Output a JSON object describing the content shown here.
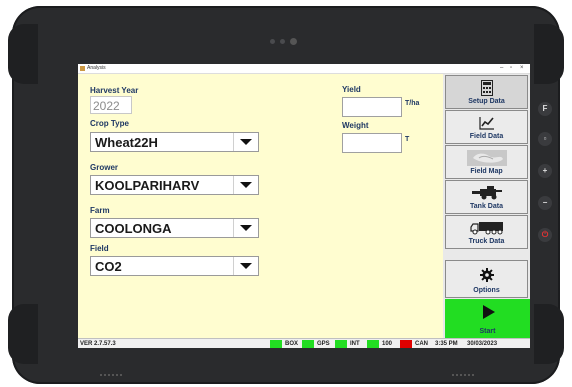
{
  "window": {
    "title": "Analysis",
    "minimize": "–",
    "maximize": "▫",
    "close": "×"
  },
  "form": {
    "harvest_year_label": "Harvest Year",
    "harvest_year_value": "2022",
    "crop_type_label": "Crop Type",
    "crop_type_value": "Wheat22H",
    "grower_label": "Grower",
    "grower_value": "KOOLPARIHARV",
    "farm_label": "Farm",
    "farm_value": "COOLONGA",
    "field_label": "Field",
    "field_value": "CO2",
    "yield_label": "Yield",
    "yield_unit": "T/ha",
    "yield_value": "",
    "weight_label": "Weight",
    "weight_unit": "T",
    "weight_value": ""
  },
  "sidebar": {
    "items": [
      {
        "label": "Setup Data",
        "icon": "calculator-icon"
      },
      {
        "label": "Field Data",
        "icon": "chart-icon"
      },
      {
        "label": "Field Map",
        "icon": "map-icon"
      },
      {
        "label": "Tank Data",
        "icon": "harvester-icon"
      },
      {
        "label": "Truck Data",
        "icon": "truck-icon"
      },
      {
        "label": "Options",
        "icon": "gear-icon"
      }
    ],
    "start_label": "Start",
    "start_color": "#22dd22"
  },
  "status": {
    "version": "VER 2.7.57.3",
    "box": "BOX",
    "gps": "GPS",
    "int": "INT",
    "num": "100",
    "can": "CAN",
    "time": "3:35 PM",
    "date": "30/03/2023",
    "ok_color": "#22dd22",
    "error_color": "#e00000"
  },
  "hardware_keys": {
    "f_key": "F"
  }
}
